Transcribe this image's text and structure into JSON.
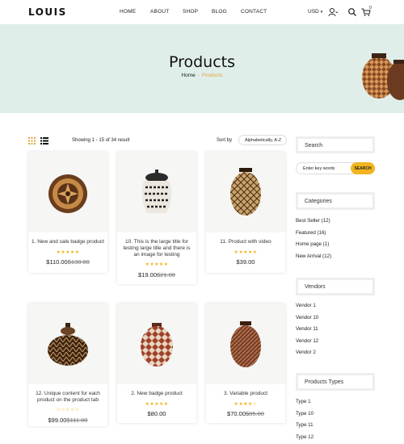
{
  "header": {
    "logo": "LOUIS",
    "nav": [
      "HOME",
      "ABOUT",
      "SHOP",
      "BLOG",
      "CONTACT"
    ],
    "currency": "USD",
    "cart_count": "0"
  },
  "hero": {
    "title": "Products",
    "breadcrumb_home": "Home",
    "breadcrumb_sep": "-",
    "breadcrumb_current": "Products"
  },
  "toolbar": {
    "showing": "Showing 1 - 15 of 34 result",
    "sort_label": "Sort by",
    "sort_value": "Alphabetically, A-Z"
  },
  "products": [
    {
      "title": "1. New and sale badge product",
      "stars": "★★★★★",
      "rating": 4.5,
      "price": "$110.00",
      "old_price": "$130.00"
    },
    {
      "title": "10. This is the large title for testing large title and there is an image for testing",
      "stars": "★★★★★",
      "rating": 4.5,
      "price": "$19.00",
      "old_price": "$21.00"
    },
    {
      "title": "11. Product with video",
      "stars": "★★★★★",
      "rating": 5,
      "price": "$39.00",
      "old_price": ""
    },
    {
      "title": "12. Unique content for each product on the product tab",
      "stars": "☆☆☆☆☆",
      "rating": 0,
      "price": "$99.00",
      "old_price": "$111.00"
    },
    {
      "title": "2. New badge product",
      "stars": "★★★★★",
      "rating": 5,
      "price": "$80.00",
      "old_price": ""
    },
    {
      "title": "3. Variable product",
      "stars": "★★★★☆",
      "rating": 4,
      "price": "$70.00",
      "old_price": "$85.00"
    }
  ],
  "sidebar": {
    "search_title": "Search",
    "search_placeholder": "Enter key words",
    "search_button": "SEARCH",
    "categories_title": "Categories",
    "categories": [
      "Best Seller (12)",
      "Featured (16)",
      "Home page (1)",
      "New Arrival (12)"
    ],
    "vendors_title": "Vendors",
    "vendors": [
      "Vendor 1",
      "Vendor 10",
      "Vendor 11",
      "Vendor 12",
      "Vendor 2"
    ],
    "types_title": "Products Types",
    "types": [
      "Type 1",
      "Type 10",
      "Type 11",
      "Type 12"
    ]
  },
  "colors": {
    "accent": "#f2b41e",
    "hero_bg": "#dfeee9",
    "breadcrumb_active": "#e3a53a"
  }
}
